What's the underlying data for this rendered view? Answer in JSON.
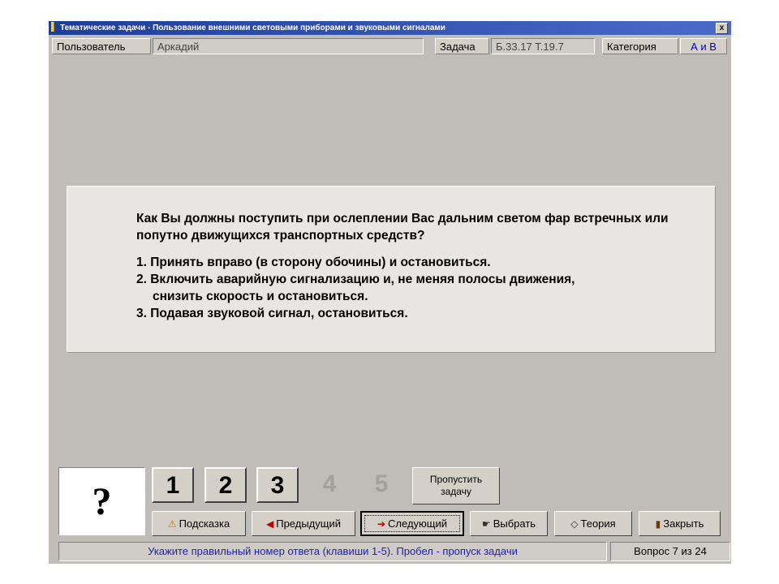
{
  "window": {
    "title": "Тематические задачи - Пользование внешними световыми приборами и звуковыми сигналами",
    "close_glyph": "x"
  },
  "infobar": {
    "user_label": "Пользователь",
    "user_value": "Аркадий",
    "task_label": "Задача",
    "task_value": "Б.33.17  Т.19.7",
    "category_label": "Категория",
    "category_value": "А и В"
  },
  "question": {
    "text": "Как Вы должны поступить при ослеплении Вас дальним светом фар встречных или попутно движущихся транспортных средств?",
    "options": [
      "1. Принять вправо (в сторону обочины) и остановиться.",
      "2. Включить аварийную сигнализацию и, не меняя полосы движения,",
      "снизить скорость и остановиться.",
      "3. Подавая звуковой сигнал, остановиться."
    ]
  },
  "answer_box": {
    "glyph": "?"
  },
  "answer_buttons": [
    "1",
    "2",
    "3",
    "4",
    "5"
  ],
  "skip_button": {
    "line1": "Пропустить",
    "line2": "задачу"
  },
  "actions": {
    "hint": "Подсказка",
    "prev": "Предыдущий",
    "next": "Следующий",
    "select": "Выбрать",
    "theory": "Теория",
    "close": "Закрыть"
  },
  "status": {
    "message": "Укажите правильный номер ответа (клавиши 1-5). Пробел - пропуск задачи",
    "counter": "Вопрос 7 из 24"
  },
  "colors": {
    "window_bg": "#c0bcb8",
    "titlebar": "#1c3e9a",
    "category_text": "#0000c8",
    "status_text": "#2020b0"
  }
}
